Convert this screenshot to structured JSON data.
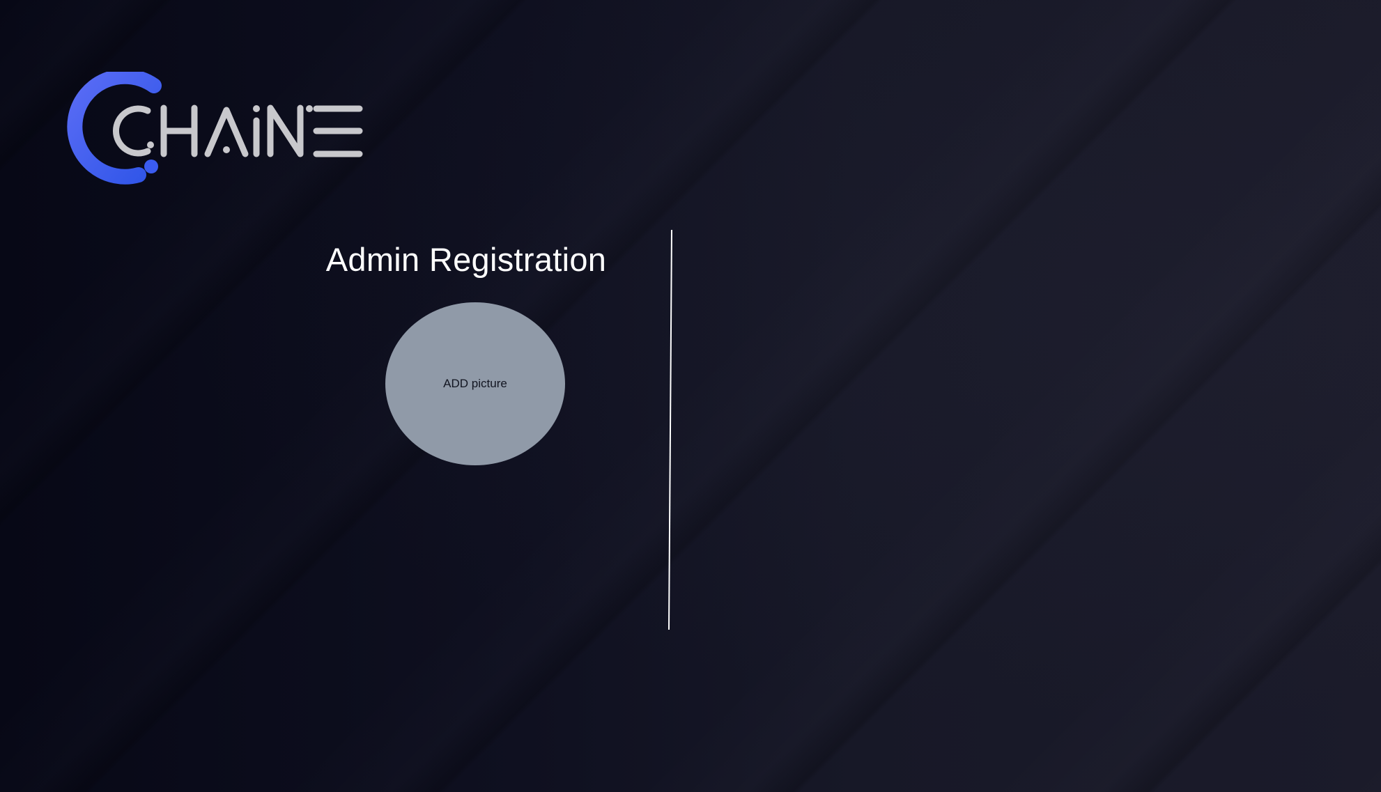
{
  "brand": {
    "name": "CHAINE",
    "accent_color": "#3b5cf0",
    "text_color": "#c8c8cc"
  },
  "page": {
    "title": "Admin Registration",
    "background_colors": [
      "#070816",
      "#1b1b2a"
    ]
  },
  "avatar": {
    "label": "ADD picture",
    "fill_color": "#909aa8"
  },
  "divider": {
    "color": "#ffffff"
  }
}
